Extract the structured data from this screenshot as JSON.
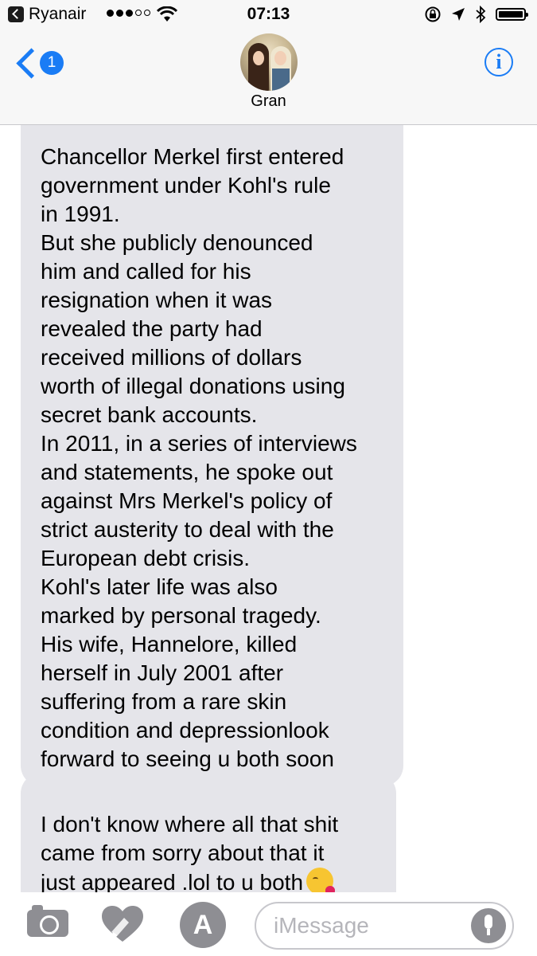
{
  "status_bar": {
    "carrier": "Ryanair",
    "signal_bars_filled": 3,
    "signal_bars_total": 5,
    "time": "07:13",
    "battery_level": 1.0
  },
  "header": {
    "unread_count": "1",
    "contact_name": "Gran",
    "info_label": "i"
  },
  "messages": [
    {
      "sender": "Gran",
      "text": "Chancellor Merkel first entered\ngovernment under Kohl's rule\nin 1991.\nBut she publicly denounced\nhim and called for his\nresignation when it was\nrevealed the party had\nreceived millions of dollars\nworth of illegal donations using\nsecret bank accounts.\nIn 2011, in a series of interviews\nand statements, he spoke out\nagainst Mrs Merkel's policy of\nstrict austerity to deal with the\nEuropean debt crisis.\nKohl's later life was also\nmarked by personal tragedy.\nHis wife, Hannelore, killed\nherself in July 2001 after\nsuffering from a rare skin\ncondition and depressionlook\nforward to seeing u both soon"
    },
    {
      "sender": "Gran",
      "text": "I don't know where all that shit\ncame from sorry about that it\njust appeared .lol to u both",
      "emoji": "face-blowing-a-kiss"
    }
  ],
  "input_bar": {
    "placeholder": "iMessage"
  },
  "colors": {
    "accent": "#1a7cf5",
    "bubble_incoming": "#e5e5ea",
    "icon_gray": "#8e8e93"
  }
}
